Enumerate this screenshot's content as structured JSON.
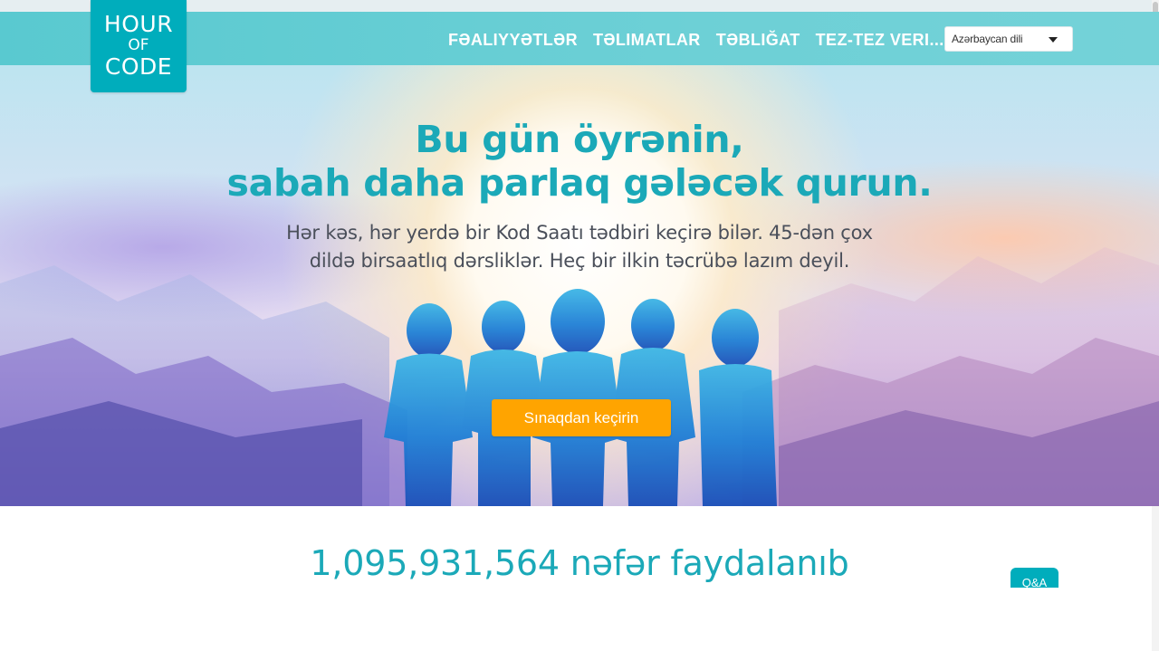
{
  "logo": {
    "line1": "HOUR",
    "line2": "OF",
    "line3": "CODE"
  },
  "nav": {
    "items": [
      {
        "label": "FƏALIYYƏTLƏR"
      },
      {
        "label": "TƏLIMATLAR"
      },
      {
        "label": "TƏBLIĞAT"
      },
      {
        "label": "TEZ-TEZ VERI..."
      }
    ],
    "language": {
      "selected": "Azərbaycan dili"
    }
  },
  "hero": {
    "headline_line1": "Bu gün öyrənin,",
    "headline_line2": "sabah daha parlaq gələcək qurun.",
    "sub_line1": "Hər kəs, hər yerdə bir Kod Saatı tədbiri keçirə bilər. 45-dən çox",
    "sub_line2": "dildə birsaatlıq dərsliklər. Heç bir ilkin təcrübə lazım deyil.",
    "cta_label": "Sınaqdan keçirin"
  },
  "stats": {
    "served_text": "1,095,931,564 nəfər faydalanıb"
  },
  "help": {
    "qa_label": "Q&A"
  },
  "colors": {
    "accent": "#00adbc",
    "cta": "#ffa400",
    "nav_bg": "#6dd0d6",
    "text_teal": "#1ba9b8"
  }
}
